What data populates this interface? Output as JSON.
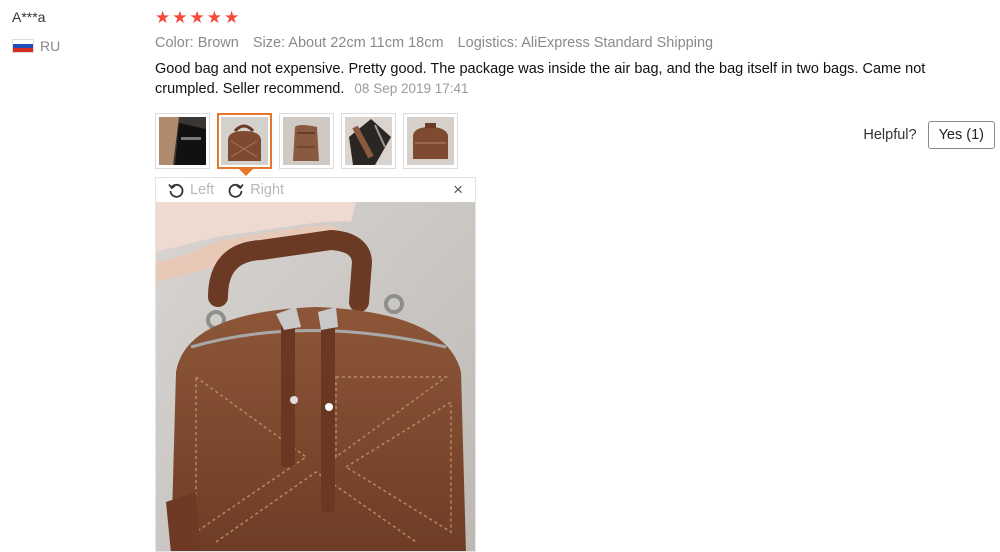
{
  "user": {
    "name": "A***a",
    "country_code": "RU",
    "flag_colors": [
      "#ffffff",
      "#1f4fb5",
      "#d52b1e"
    ]
  },
  "review": {
    "rating": 5,
    "star_glyph": "★",
    "star_color": "#f44b3a",
    "color": "Color: Brown",
    "size": "Size: About 22cm 11cm 18cm",
    "logistics": "Logistics: AliExpress Standard Shipping",
    "text": "Good bag and not expensive. Pretty good. The package was inside the air bag, and the bag itself in two bags. Came not crumpled. Seller recommend.",
    "date": "08 Sep 2019 17:41"
  },
  "helpful": {
    "label": "Helpful?",
    "yes_label": "Yes (1)"
  },
  "viewer": {
    "rotate_left": "Left",
    "rotate_right": "Right",
    "close_glyph": "×",
    "active_thumb_index": 1,
    "thumb_count": 5
  },
  "colors": {
    "accent_orange": "#e8762a",
    "leather_brown": "#8a5a3c"
  }
}
